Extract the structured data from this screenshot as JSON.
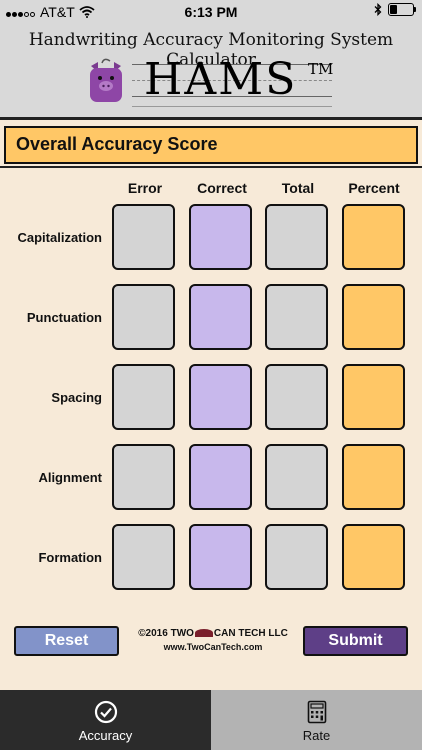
{
  "status_bar": {
    "carrier": "AT&T",
    "time": "6:13 PM"
  },
  "header": {
    "title": "Handwriting Accuracy Monitoring System Calculator",
    "logo_text": "HAMS",
    "trademark": "TM"
  },
  "score_banner": {
    "label": "Overall Accuracy Score"
  },
  "columns": [
    "Error",
    "Correct",
    "Total",
    "Percent"
  ],
  "rows": [
    "Capitalization",
    "Punctuation",
    "Spacing",
    "Alignment",
    "Formation"
  ],
  "footer": {
    "reset_label": "Reset",
    "submit_label": "Submit",
    "copyright_prefix": "©2016 TWO",
    "copyright_suffix": "CAN TECH LLC",
    "url": "www.TwoCanTech.com"
  },
  "tabs": [
    {
      "label": "Accuracy",
      "icon": "check-circle-icon",
      "active": true
    },
    {
      "label": "Rate",
      "icon": "calculator-icon",
      "active": false
    }
  ],
  "colors": {
    "background": "#f7ead8",
    "header_gray": "#d9d9d9",
    "error_total_cell": "#d4d4d4",
    "correct_cell": "#c8b8ec",
    "percent_cell": "#ffc766",
    "reset_button": "#8293c9",
    "submit_button": "#5e3f87",
    "active_tab": "#2b2b2b",
    "inactive_tab": "#b3b3b3"
  }
}
